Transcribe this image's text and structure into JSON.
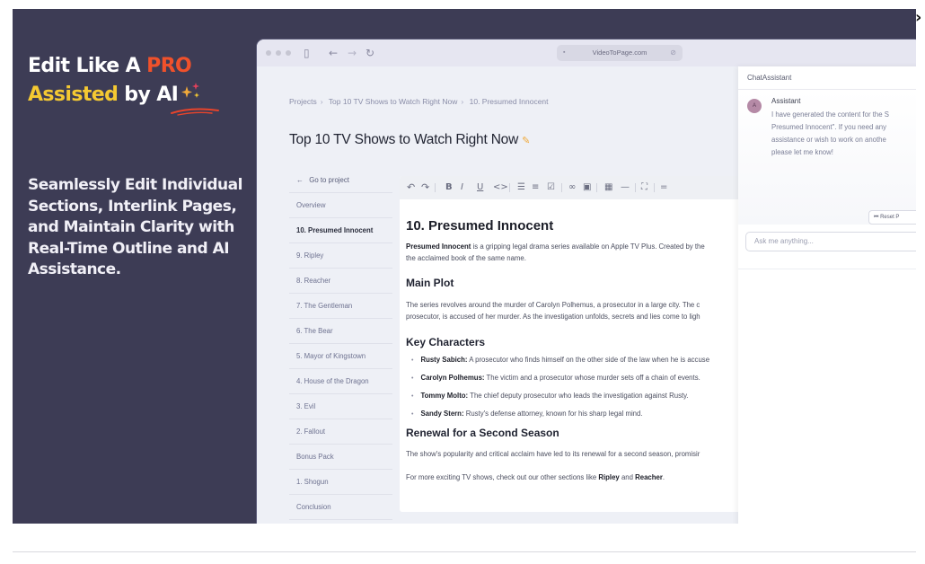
{
  "hero": {
    "line1_prefix": "Edit Like A ",
    "line1_highlight": "PRO",
    "line2_highlight": "Assisted",
    "line2_suffix": " by AI",
    "tagline": "Seamlessly Edit Individual Sections, Interlink Pages, and Maintain Clarity with Real-Time Outline and AI Assistance.",
    "colors": {
      "background": "#3d3c55",
      "pro": "#f0512b",
      "assisted": "#f5c932"
    }
  },
  "nav": {
    "next_icon": "chevron-right-icon",
    "next_glyph": "›"
  },
  "browser": {
    "url": "VideoToPage.com",
    "icons": {
      "sidebar": "▯",
      "back": "←",
      "forward": "→",
      "reload": "↻",
      "lock": "🔒",
      "link": "🔗"
    }
  },
  "breadcrumb": [
    "Projects",
    "Top 10 TV Shows to Watch Right Now",
    "10. Presumed Innocent"
  ],
  "breadcrumb_sep": "›",
  "page": {
    "title": "Top 10 TV Shows to Watch Right Now",
    "edit_glyph": "✎"
  },
  "outline": {
    "back_label": "Go to project",
    "back_glyph": "←",
    "items": [
      "Overview",
      "10. Presumed Innocent",
      "9. Ripley",
      "8. Reacher",
      "7. The Gentleman",
      "6. The Bear",
      "5. Mayor of Kingstown",
      "4. House of the Dragon",
      "3. Evil",
      "2. Fallout",
      "Bonus Pack",
      "1. Shogun",
      "Conclusion"
    ],
    "active_index": 1
  },
  "editor": {
    "toolbar": [
      {
        "name": "undo",
        "glyph": "↶"
      },
      {
        "name": "redo",
        "glyph": "↷"
      },
      {
        "name": "bold",
        "glyph": "B"
      },
      {
        "name": "italic",
        "glyph": "I"
      },
      {
        "name": "underline",
        "glyph": "U"
      },
      {
        "name": "code",
        "glyph": "<>"
      },
      {
        "name": "bullet-list",
        "glyph": "☰"
      },
      {
        "name": "ordered-list",
        "glyph": "≡"
      },
      {
        "name": "task-list",
        "glyph": "☑"
      },
      {
        "name": "link",
        "glyph": "∞"
      },
      {
        "name": "image",
        "glyph": "▣"
      },
      {
        "name": "table",
        "glyph": "▦"
      },
      {
        "name": "horizontal-rule",
        "glyph": "—"
      },
      {
        "name": "fullscreen",
        "glyph": "⛶"
      },
      {
        "name": "more",
        "glyph": "="
      }
    ],
    "heading": "10. Presumed Innocent",
    "intro_bold": "Presumed Innocent",
    "intro_line1": " is a gripping legal drama series available on Apple TV Plus. Created by the",
    "intro_line2": "the acclaimed book of the same name.",
    "main_plot_heading": "Main Plot",
    "main_plot_line1": "The series revolves around the murder of Carolyn Polhemus, a prosecutor in a large city. The c",
    "main_plot_line2": "prosecutor, is accused of her murder. As the investigation unfolds, secrets and lies come to ligh",
    "characters_heading": "Key Characters",
    "characters": [
      {
        "name": "Rusty Sabich:",
        "desc": " A prosecutor who finds himself on the other side of the law when he is accuse"
      },
      {
        "name": "Carolyn Polhemus:",
        "desc": " The victim and a prosecutor whose murder sets off a chain of events."
      },
      {
        "name": "Tommy Molto:",
        "desc": " The chief deputy prosecutor who leads the investigation against Rusty."
      },
      {
        "name": "Sandy Stern:",
        "desc": " Rusty's defense attorney, known for his sharp legal mind."
      }
    ],
    "renewal_heading": "Renewal for a Second Season",
    "renewal_line": "The show's popularity and critical acclaim have led to its renewal for a second season, promisir",
    "closing_prefix": "For more exciting TV shows, check out our other sections like ",
    "closing_link1": "Ripley",
    "closing_mid": " and ",
    "closing_link2": "Reacher",
    "closing_suffix": "."
  },
  "chat": {
    "title": "ChatAssistant",
    "avatar_letter": "A",
    "sender": "Assistant",
    "message_lines": [
      "I have generated the content for the S",
      "Presumed Innocent\". If you need any",
      "assistance or wish to work on anothe",
      "please let me know!"
    ],
    "reset_label": "⏮ Reset P",
    "input_placeholder": "Ask me anything..."
  }
}
